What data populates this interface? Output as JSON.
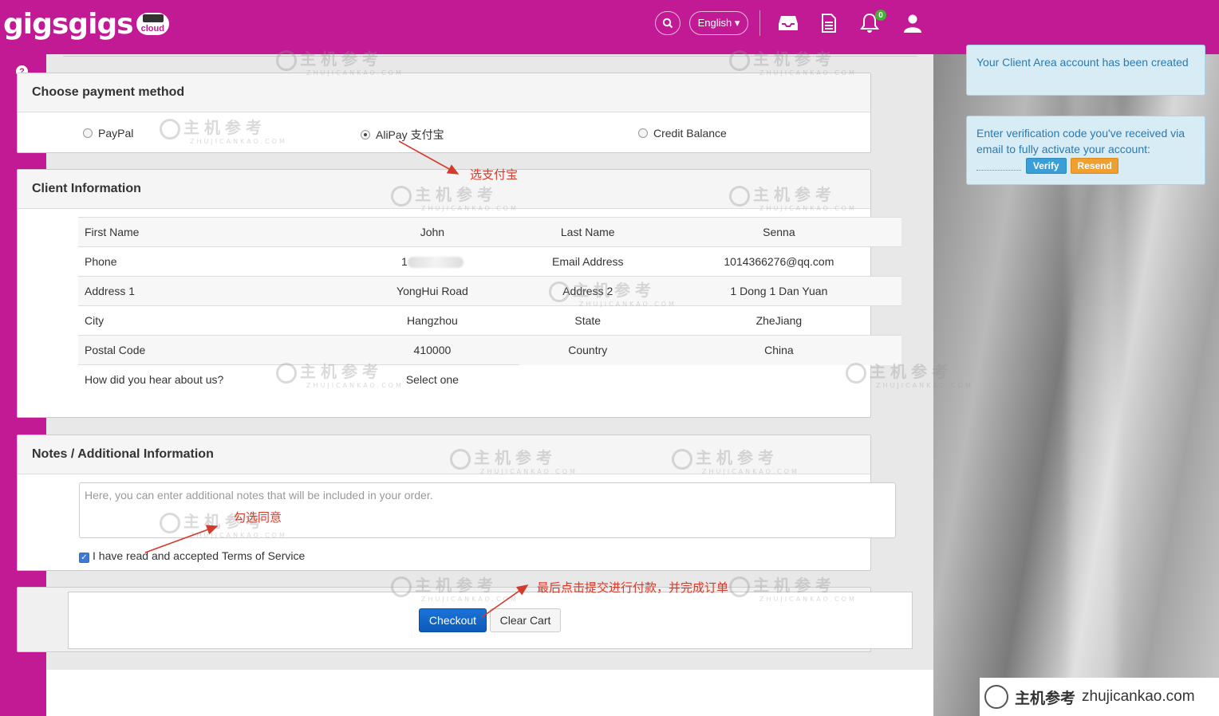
{
  "header": {
    "logo_text": "gigsgigs",
    "logo_sub": "cloud",
    "language": "English ▾",
    "notification_count": "0"
  },
  "payment": {
    "title": "Choose payment method",
    "options": [
      {
        "label": "PayPal",
        "selected": false
      },
      {
        "label": "AliPay 支付宝",
        "selected": true
      },
      {
        "label": "Credit Balance",
        "selected": false
      }
    ]
  },
  "client": {
    "title": "Client Information",
    "rows": [
      [
        "First Name",
        "John",
        "Last Name",
        "Senna"
      ],
      [
        "Phone",
        "1",
        "Email Address",
        "1014366276@qq.com"
      ],
      [
        "Address 1",
        "YongHui Road",
        "Address 2",
        "1 Dong 1 Dan Yuan"
      ],
      [
        "City",
        "Hangzhou",
        "State",
        "ZheJiang"
      ],
      [
        "Postal Code",
        "410000",
        "Country",
        "China"
      ],
      [
        "How did you hear about us?",
        "Select one",
        "",
        ""
      ]
    ]
  },
  "notes": {
    "title": "Notes / Additional Information",
    "placeholder": "Here, you can enter additional notes that will be included in your order.",
    "tos_text": "I have read and accepted",
    "tos_link": "Terms of Service",
    "tos_checked": true
  },
  "actions": {
    "checkout": "Checkout",
    "clear_cart": "Clear Cart"
  },
  "toasts": {
    "created": "Your Client Area account has been created",
    "verify_text": "Enter verification code you've received via email to fully activate your account:",
    "verify_button": "Verify",
    "resend_button": "Resend"
  },
  "annotations": {
    "choose_alipay": "选支付宝",
    "tick_agree": "勾选同意",
    "final_step": "最后点击提交进行付款，并完成订单"
  },
  "watermark": {
    "cn": "主机参考",
    "en": "ZHUJICANKAO.COM",
    "banner_cn": "主机参考",
    "banner_url": "zhujicankao.com"
  },
  "colors": {
    "brand": "#c21a94",
    "checkout": "#1565c8",
    "annotation": "#d63a2a",
    "toast_bg": "#d8ecf6"
  }
}
